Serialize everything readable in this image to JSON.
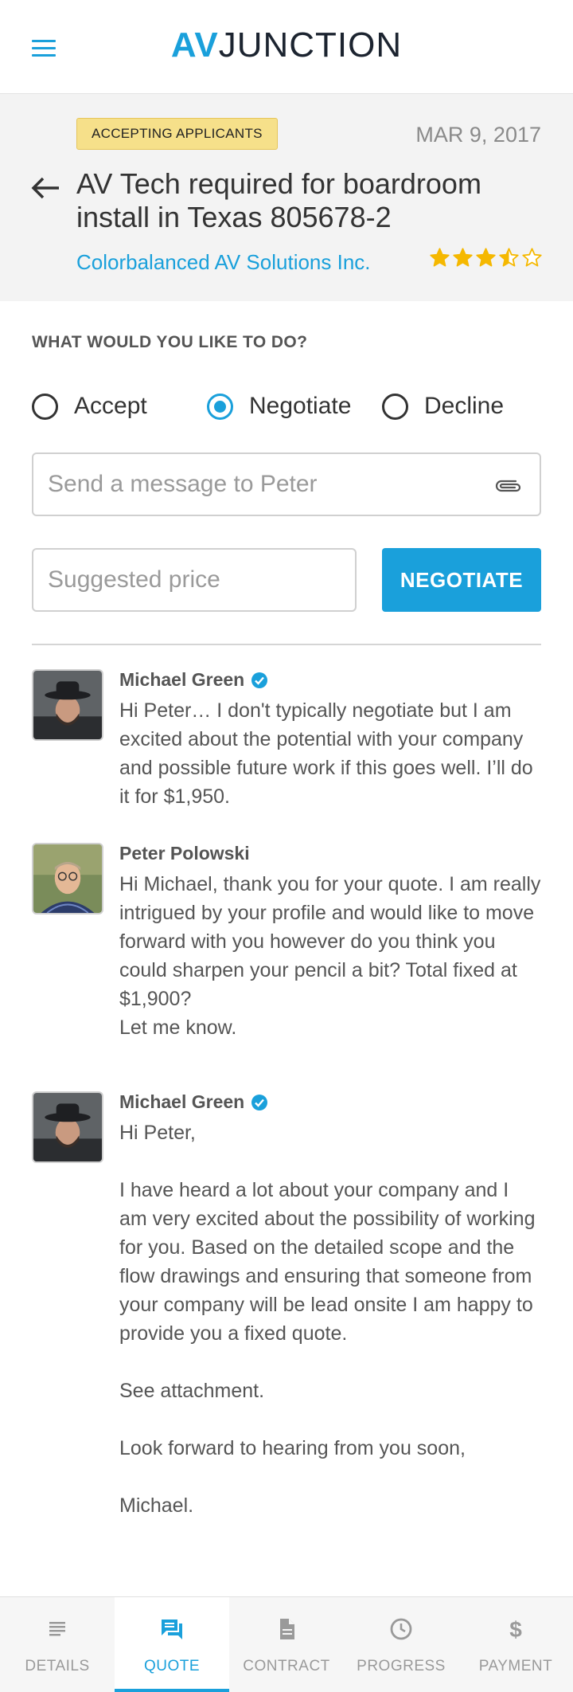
{
  "app": {
    "logo_bold": "AV",
    "logo_rest": "JUNCTION",
    "menu_icon": "hamburger-menu-icon"
  },
  "job": {
    "status_badge": "ACCEPTING APPLICANTS",
    "date": "MAR 9, 2017",
    "title": "AV Tech required for boardroom install in Texas 805678-2",
    "company": "Colorbalanced AV Solutions Inc.",
    "rating": 3.5,
    "rating_max": 5,
    "star_color": "#f5b800"
  },
  "action": {
    "prompt": "WHAT WOULD YOU LIKE TO DO?",
    "options": [
      {
        "label": "Accept",
        "selected": false
      },
      {
        "label": "Negotiate",
        "selected": true
      },
      {
        "label": "Decline",
        "selected": false
      }
    ],
    "message_placeholder": "Send a message to Peter",
    "message_value": "",
    "price_placeholder": "Suggested price",
    "price_value": "",
    "submit_label": "NEGOTIATE"
  },
  "messages": [
    {
      "sender": "Michael Green",
      "verified": true,
      "avatar": "michael-green",
      "text": "Hi Peter… I don't typically negotiate but I am excited about the potential with your company and possible future work if this goes well.  I’ll do it for $1,950."
    },
    {
      "sender": "Peter Polowski",
      "verified": false,
      "avatar": "peter-polowski",
      "text": "Hi Michael, thank you for your quote.  I am really intrigued by your profile and would like to move forward with you however do you think you could sharpen your pencil a bit?  Total fixed at $1,900?\nLet me know."
    },
    {
      "sender": "Michael Green",
      "verified": true,
      "avatar": "michael-green",
      "text": "Hi Peter,\n\nI have heard a lot about your company and I am very excited about the possibility of working for you.  Based on the detailed scope and the flow drawings and ensuring that someone from your company will be lead onsite I am happy to provide you a fixed quote.\n\nSee attachment.\n\nLook forward to hearing from you soon,\n\nMichael."
    }
  ],
  "nav": {
    "items": [
      {
        "label": "DETAILS",
        "icon": "details-list-icon",
        "active": false
      },
      {
        "label": "QUOTE",
        "icon": "chat-bubble-icon",
        "active": true
      },
      {
        "label": "CONTRACT",
        "icon": "document-icon",
        "active": false
      },
      {
        "label": "PROGRESS",
        "icon": "clock-icon",
        "active": false
      },
      {
        "label": "PAYMENT",
        "icon": "dollar-icon",
        "active": false
      }
    ]
  },
  "colors": {
    "accent": "#1aa0db",
    "badge_bg": "#f6e08a",
    "header_bg": "#f3f3f3"
  }
}
